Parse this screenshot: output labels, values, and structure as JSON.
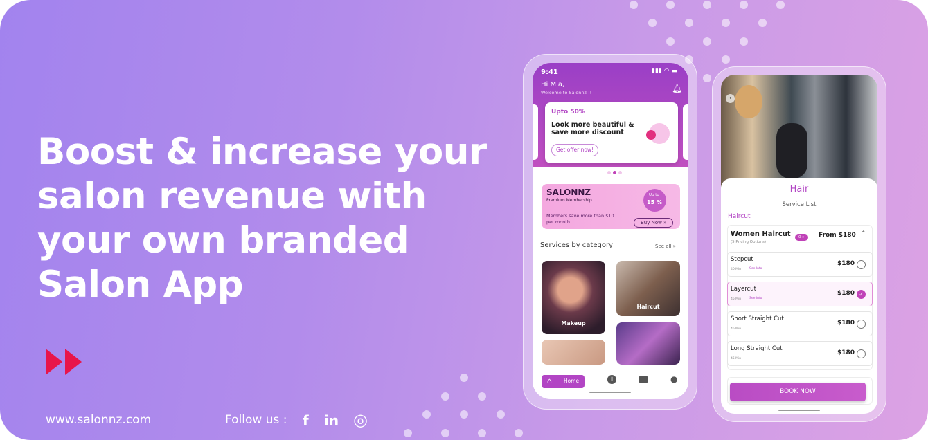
{
  "headline": {
    "line1": "Boost & increase your",
    "line2": "salon revenue with",
    "line3": "your own branded",
    "line4": "Salon App"
  },
  "footer": {
    "website": "www.salonnz.com",
    "follow": "Follow us :",
    "facebook": "f",
    "linkedin": "in",
    "instagram": "◎"
  },
  "colors": {
    "accent": "#e8154a",
    "brand": "#b245c4"
  },
  "phone1": {
    "time": "9:41",
    "greeting": "Hi Mia,",
    "welcome": "Welcome to Salonnz !!",
    "offer": {
      "badge": "Upto 50%",
      "line1": "Look more beautiful &",
      "line2": "save more discount",
      "cta": "Get offer now!"
    },
    "membership": {
      "brand": "SALONNZ",
      "sub": "Premium Membership",
      "desc1": "Members save more than $10",
      "desc2": "per month",
      "upto": "Up to",
      "pct": "15 %",
      "cta": "Buy Now »"
    },
    "section": {
      "title": "Services by category",
      "see_all": "See all »"
    },
    "categories": [
      "Makeup",
      "Haircut"
    ],
    "nav": {
      "home": "Home"
    }
  },
  "phone2": {
    "title": "Hair",
    "subtitle": "Service List",
    "group": "Haircut",
    "parent": {
      "name": "Women Haircut",
      "sub": "(5 Pricing Options)",
      "badge": "0 »",
      "price": "From $180"
    },
    "options": [
      {
        "name": "Stepcut",
        "time": "40 Min",
        "info": "See Info",
        "price": "$180",
        "selected": false
      },
      {
        "name": "Layercut",
        "time": "45 Min",
        "info": "See Info",
        "price": "$180",
        "selected": true
      },
      {
        "name": "Short Straight Cut",
        "time": "45 Min",
        "info": "",
        "price": "$180",
        "selected": false
      },
      {
        "name": "Long Straight Cut",
        "time": "45 Min",
        "info": "",
        "price": "$180",
        "selected": false
      }
    ],
    "book": "BOOK NOW"
  }
}
